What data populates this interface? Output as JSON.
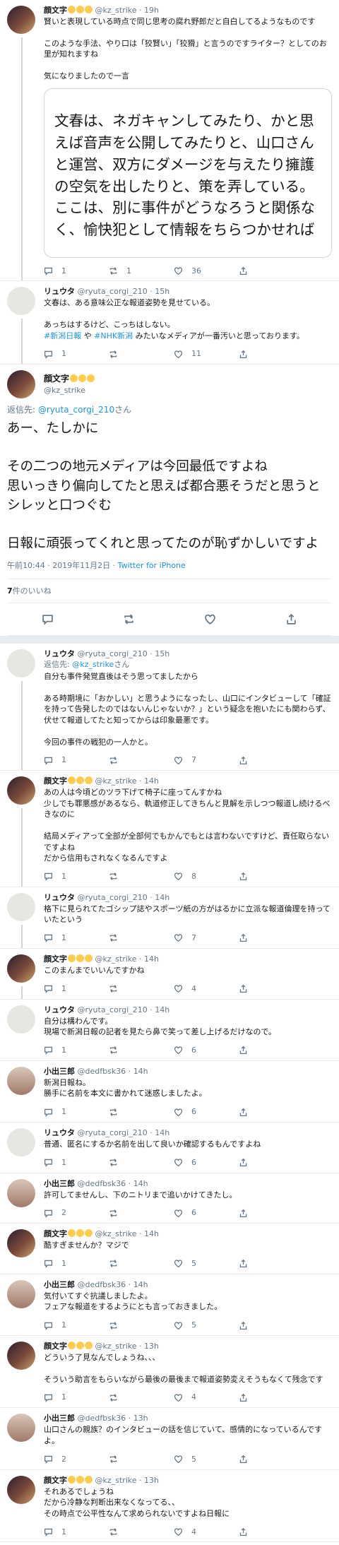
{
  "colors": {
    "link": "#1b95e0",
    "muted": "#657786",
    "border": "#e6ecf0"
  },
  "t0": {
    "name": "顔文字",
    "handle": "@kz_strike",
    "time": "19h",
    "lines": [
      "賢いと表現している時点で同じ思考の腐れ野郎だと自白してるようなものです",
      "",
      "このような手法、やり口は「狡賢い」「狡猾」と言うのですライター？としてのお里が知れますね",
      "",
      "気になりましたので一言"
    ],
    "quote": "文春は、ネガキャンしてみたり、かと思えば音声を公開してみたりと、山口さんと運営、双方にダメージを与えたり擁護の空気を出したりと、策を弄している。ここは、別に事件がどうなろうと関係なく、愉快犯として情報をちらつかせれば",
    "reply": "1",
    "rt": "1",
    "like": "36"
  },
  "t1": {
    "name": "リュウタ",
    "handle": "@ryuta_corgi_210",
    "time": "15h",
    "lines": [
      "文春は、ある意味公正な報道姿勢を見せている。",
      "",
      "あっちはするけど、こっちはしない。"
    ],
    "tag1": "#新潟日報",
    "mid": " や ",
    "tag2": "#NHK新潟",
    "tail": " みたいなメディアが一番汚いと思っております。",
    "reply": "1",
    "rt": "",
    "like": "11"
  },
  "main": {
    "name": "顔文字",
    "handle": "@kz_strike",
    "reply_prefix": "返信先: ",
    "reply_to": "@ryuta_corgi_210",
    "reply_suffix": "さん",
    "lines": [
      "あー、たしかに",
      "",
      "その二つの地元メディアは今回最低ですよね",
      "思いっきり偏向してたと思えば都合悪そうだと思うとシレッと口つぐむ",
      "",
      "日報に頑張ってくれと思ってたのが恥ずかしいですよ"
    ],
    "time": "午前10:44 · 2019年11月2日 · ",
    "client": "Twitter for iPhone",
    "likes_count": "7",
    "likes_label": "件のいいね"
  },
  "replies": [
    {
      "who": "ry",
      "name": "リュウタ",
      "handle": "@ryuta_corgi_210",
      "time": "15h",
      "reply_to": "@kz_strike",
      "lines": [
        "自分も事件発覚直後はそう思ってましたから",
        "",
        "ある時期境に「おかしい」と思うようになったし、山口にインタビューして「確証を持って告発したのではないんじゃないか？」という疑念を抱いたにも関わらず、伏せて報道してたと知ってからは印象最悪です。",
        "",
        "今回の事件の戦犯の一人かと。"
      ],
      "reply": "1",
      "rt": "",
      "like": "7",
      "thread": true
    },
    {
      "who": "kz",
      "name": "顔文字",
      "handle": "@kz_strike",
      "time": "14h",
      "lines": [
        "あの人は今頃どのツラ下げて椅子に座ってんすかね",
        "少しでも罪悪感があるなら、軌道修正してきちんと見解を示しつつ報道し続けるべきなのに",
        "",
        "結局メディアって全部が全部何でもかんでもとは言わないですけど、責任取らないですよね",
        "だから信用もされなくなるんですよ"
      ],
      "reply": "1",
      "rt": "",
      "like": "8",
      "thread": true
    },
    {
      "who": "ry",
      "name": "リュウタ",
      "handle": "@ryuta_corgi_210",
      "time": "14h",
      "lines": [
        "格下に見られてたゴシップ誌やスポーツ紙の方がはるかに立派な報道倫理を持っていたという"
      ],
      "reply": "1",
      "rt": "",
      "like": "7",
      "thread": true
    },
    {
      "who": "kz",
      "name": "顔文字",
      "handle": "@kz_strike",
      "time": "14h",
      "lines": [
        "このまんまでいいんですかね"
      ],
      "reply": "1",
      "rt": "",
      "like": "4",
      "thread": true
    },
    {
      "who": "ry",
      "name": "リュウタ",
      "handle": "@ryuta_corgi_210",
      "time": "14h",
      "lines": [
        "自分は構わんです。",
        "現場で新潟日報の記者を見たら鼻で笑って差し上げるだけなので。"
      ],
      "reply": "1",
      "rt": "",
      "like": "6",
      "thread": false
    },
    {
      "who": "de",
      "name": "小出三郎",
      "handle": "@dedfbsk36",
      "time": "14h",
      "lines": [
        "新潟日報ね。",
        "勝手に名前を本文に書かれて迷惑しましたよ。"
      ],
      "reply": "1",
      "rt": "",
      "like": "6",
      "thread": false
    },
    {
      "who": "ry",
      "name": "リュウタ",
      "handle": "@ryuta_corgi_210",
      "time": "14h",
      "lines": [
        "普通、匿名にするか名前を出して良いか確認するもんですよね"
      ],
      "reply": "1",
      "rt": "",
      "like": "6",
      "thread": false
    },
    {
      "who": "de",
      "name": "小出三郎",
      "handle": "@dedfbsk36",
      "time": "14h",
      "lines": [
        "許可してませんし、下のニトリまで追いかけてきたし。"
      ],
      "reply": "2",
      "rt": "",
      "like": "6",
      "thread": false
    },
    {
      "who": "kz",
      "name": "顔文字",
      "handle": "@kz_strike",
      "time": "14h",
      "lines": [
        "酷すぎませんか？マジで"
      ],
      "reply": "1",
      "rt": "",
      "like": "5",
      "thread": false
    },
    {
      "who": "de",
      "name": "小出三郎",
      "handle": "@dedfbsk36",
      "time": "14h",
      "lines": [
        "気付いてすぐ抗議しましたよ。",
        "フェアな報道をするようにとも言っておきました。"
      ],
      "reply": "1",
      "rt": "",
      "like": "5",
      "thread": false
    },
    {
      "who": "kz",
      "name": "顔文字",
      "handle": "@kz_strike",
      "time": "13h",
      "lines": [
        "どういう了見なんでしょうね、、、",
        "",
        "そういう助言をもらいながら最後の最後まで報道姿勢変えそうもなくて残念です"
      ],
      "reply": "1",
      "rt": "",
      "like": "4",
      "thread": false
    },
    {
      "who": "de",
      "name": "小出三郎",
      "handle": "@dedfbsk36",
      "time": "13h",
      "lines": [
        "山口さんの親族？のインタビューの話を信じていて、感情的になっているんですよ。"
      ],
      "reply": "2",
      "rt": "",
      "like": "5",
      "thread": false
    },
    {
      "who": "kz",
      "name": "顔文字",
      "handle": "@kz_strike",
      "time": "13h",
      "lines": [
        "それあるでしょうね",
        "だから冷静な判断出来なくなってる、、",
        "その時点で公平性なんて求められないですよね日報に"
      ],
      "reply": "1",
      "rt": "",
      "like": "4",
      "thread": false
    }
  ]
}
